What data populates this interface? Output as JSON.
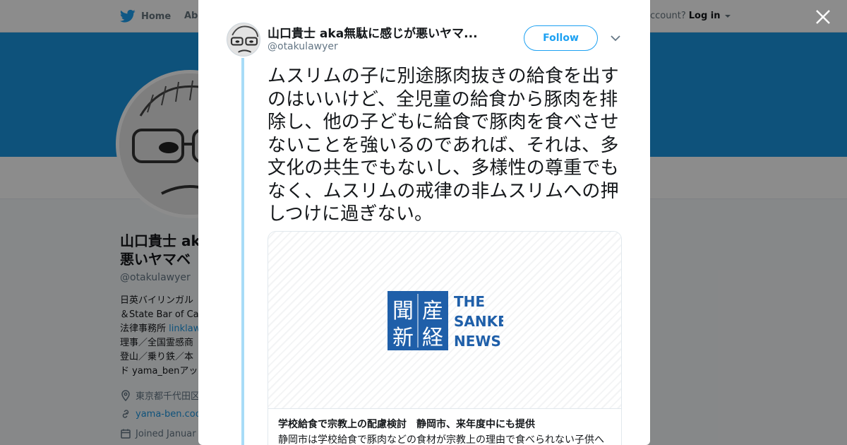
{
  "nav": {
    "home_label": "Home",
    "about_label": "Abo",
    "account_prompt": "ccount?",
    "login_label": "Log in"
  },
  "profile": {
    "name": "山口貴士 aka 悪いヤマベ",
    "handle": "@otakulawyer",
    "bio_line1": "日英バイリンガル",
    "bio_line2": "＆State Bar of Ca",
    "bio_line3_prefix": "法律事務所 ",
    "bio_line3_link": "linklaw",
    "bio_line4": "理事／全国霊感商",
    "bio_line5": "登山／乗り鉄／本",
    "bio_line6": "ド yama_benアッ",
    "location": "東京都千代田区",
    "website": "yama-ben.coo",
    "joined": "Joined Januar"
  },
  "tweet": {
    "author_name": "山口貴士 aka無駄に感じが悪いヤマ...",
    "author_handle": "@otakulawyer",
    "follow_label": "Follow",
    "text": "ムスリムの子に別途豚肉抜きの給食を出すのはいいけど、全児童の給食から豚肉を排除し、他の子どもに給食で豚肉を食べさせないことを強いるのであれば、それは、多文化の共生でもないし、多様性の尊重でもなく、ムスリムの戒律の非ムスリムへの押しつけに過ぎない。"
  },
  "card": {
    "logo_text_en": [
      "THE",
      "SANKEI",
      "NEWS"
    ],
    "logo_kanji": [
      "産",
      "経",
      "新",
      "聞"
    ],
    "title": "学校給食で宗教上の配慮検討　静岡市、来年度中にも提供",
    "description": "静岡市は学校給食で豚肉などの食材が宗教上の理由で食べられない子供へ"
  },
  "colors": {
    "brand_blue": "#1da1f2",
    "banner_blue": "#1b95e0",
    "sankei_blue": "#1f5fa9"
  },
  "icons": [
    "twitter-bird-icon",
    "caret-down-icon",
    "close-icon",
    "chevron-down-icon",
    "location-pin-icon",
    "link-icon",
    "calendar-icon"
  ]
}
